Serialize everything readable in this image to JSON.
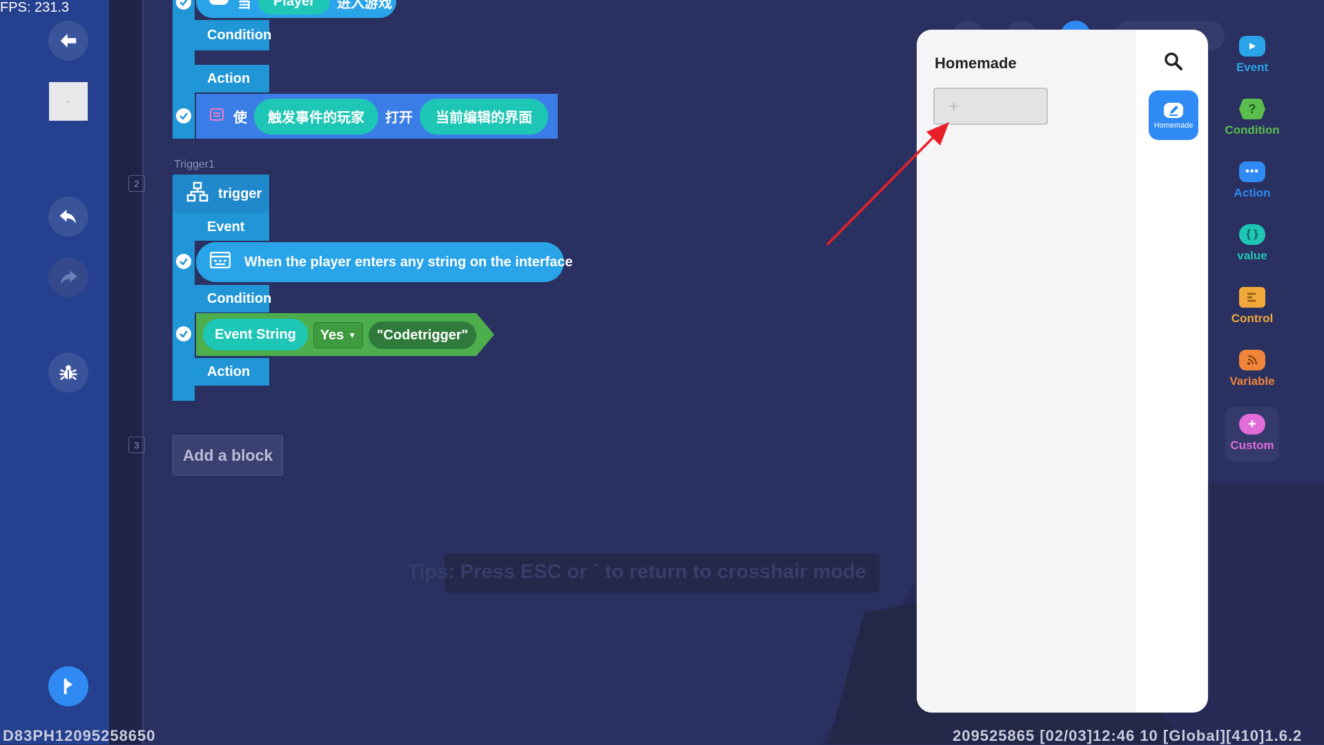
{
  "fps": "FPS: 231.3",
  "blocks": {
    "event1": {
      "player_chip": "Player",
      "prefix": "当",
      "suffix": "进入游戏"
    },
    "condition_label": "Condition",
    "action_label": "Action",
    "action1": {
      "verb": "使",
      "arg1": "触发事件的玩家",
      "mid": "打开",
      "arg2": "当前编辑的界面"
    },
    "trigger1": {
      "name": "Trigger1",
      "header": "trigger",
      "event_label": "Event",
      "event_text": "When the player enters any string on the interface",
      "condition_label": "Condition",
      "cond_left": "Event String",
      "cond_op": "Yes",
      "cond_right": "\"Codetrigger\"",
      "action_label": "Action"
    },
    "gutter_numbers": [
      "2",
      "3"
    ],
    "add_block": "Add a block"
  },
  "tips": "Tips: Press ESC or ` to return to crosshair mode",
  "panel": {
    "title": "Homemade",
    "tab_label": "Homemade",
    "new_block_icon": "+"
  },
  "categories": [
    {
      "label": "Event",
      "color": "#2aa4e8",
      "icon": "play-icon"
    },
    {
      "label": "Condition",
      "color": "#5bbd4e",
      "icon": "question-icon"
    },
    {
      "label": "Action",
      "color": "#2f8bf3",
      "icon": "dots-icon"
    },
    {
      "label": "value",
      "color": "#1ec6b6",
      "icon": "braces-icon"
    },
    {
      "label": "Control",
      "color": "#f0a83a",
      "icon": "control-icon"
    },
    {
      "label": "Variable",
      "color": "#f0853a",
      "icon": "rss-icon"
    },
    {
      "label": "Custom",
      "color": "#e26cd8",
      "icon": "plus-cloud-icon"
    }
  ],
  "footer": {
    "device_id": "D83PH12095258650",
    "info": "209525865    [02/03]12:46 10  [Global][410]1.6.2"
  }
}
